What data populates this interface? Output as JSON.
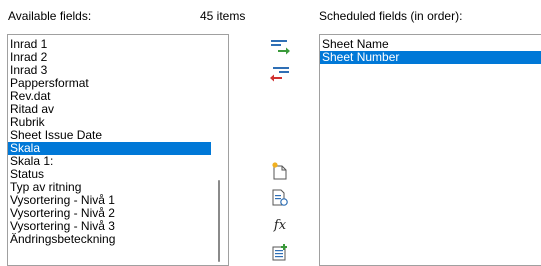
{
  "left": {
    "header": "Available fields:",
    "count": "45 items",
    "items": [
      "Inrad 1",
      "Inrad 2",
      "Inrad 3",
      "Pappersformat",
      "Rev.dat",
      "Ritad av",
      "Rubrik",
      "Sheet Issue Date",
      "Skala",
      "Skala 1:",
      "Status",
      "Typ av ritning",
      "Vysortering - Nivå 1",
      "Vysortering - Nivå 2",
      "Vysortering - Nivå 3",
      "Ändringsbeteckning"
    ],
    "selected_index": 8
  },
  "right": {
    "header": "Scheduled fields (in order):",
    "items": [
      "Sheet Name",
      "Sheet Number"
    ],
    "selected_index": 1
  },
  "buttons": {
    "fx_label": "fx"
  },
  "colors": {
    "selection": "#0078d7",
    "add_arrow": "#3a9a3a",
    "remove_arrow": "#d03030",
    "icon_blue": "#2f6fb5"
  }
}
